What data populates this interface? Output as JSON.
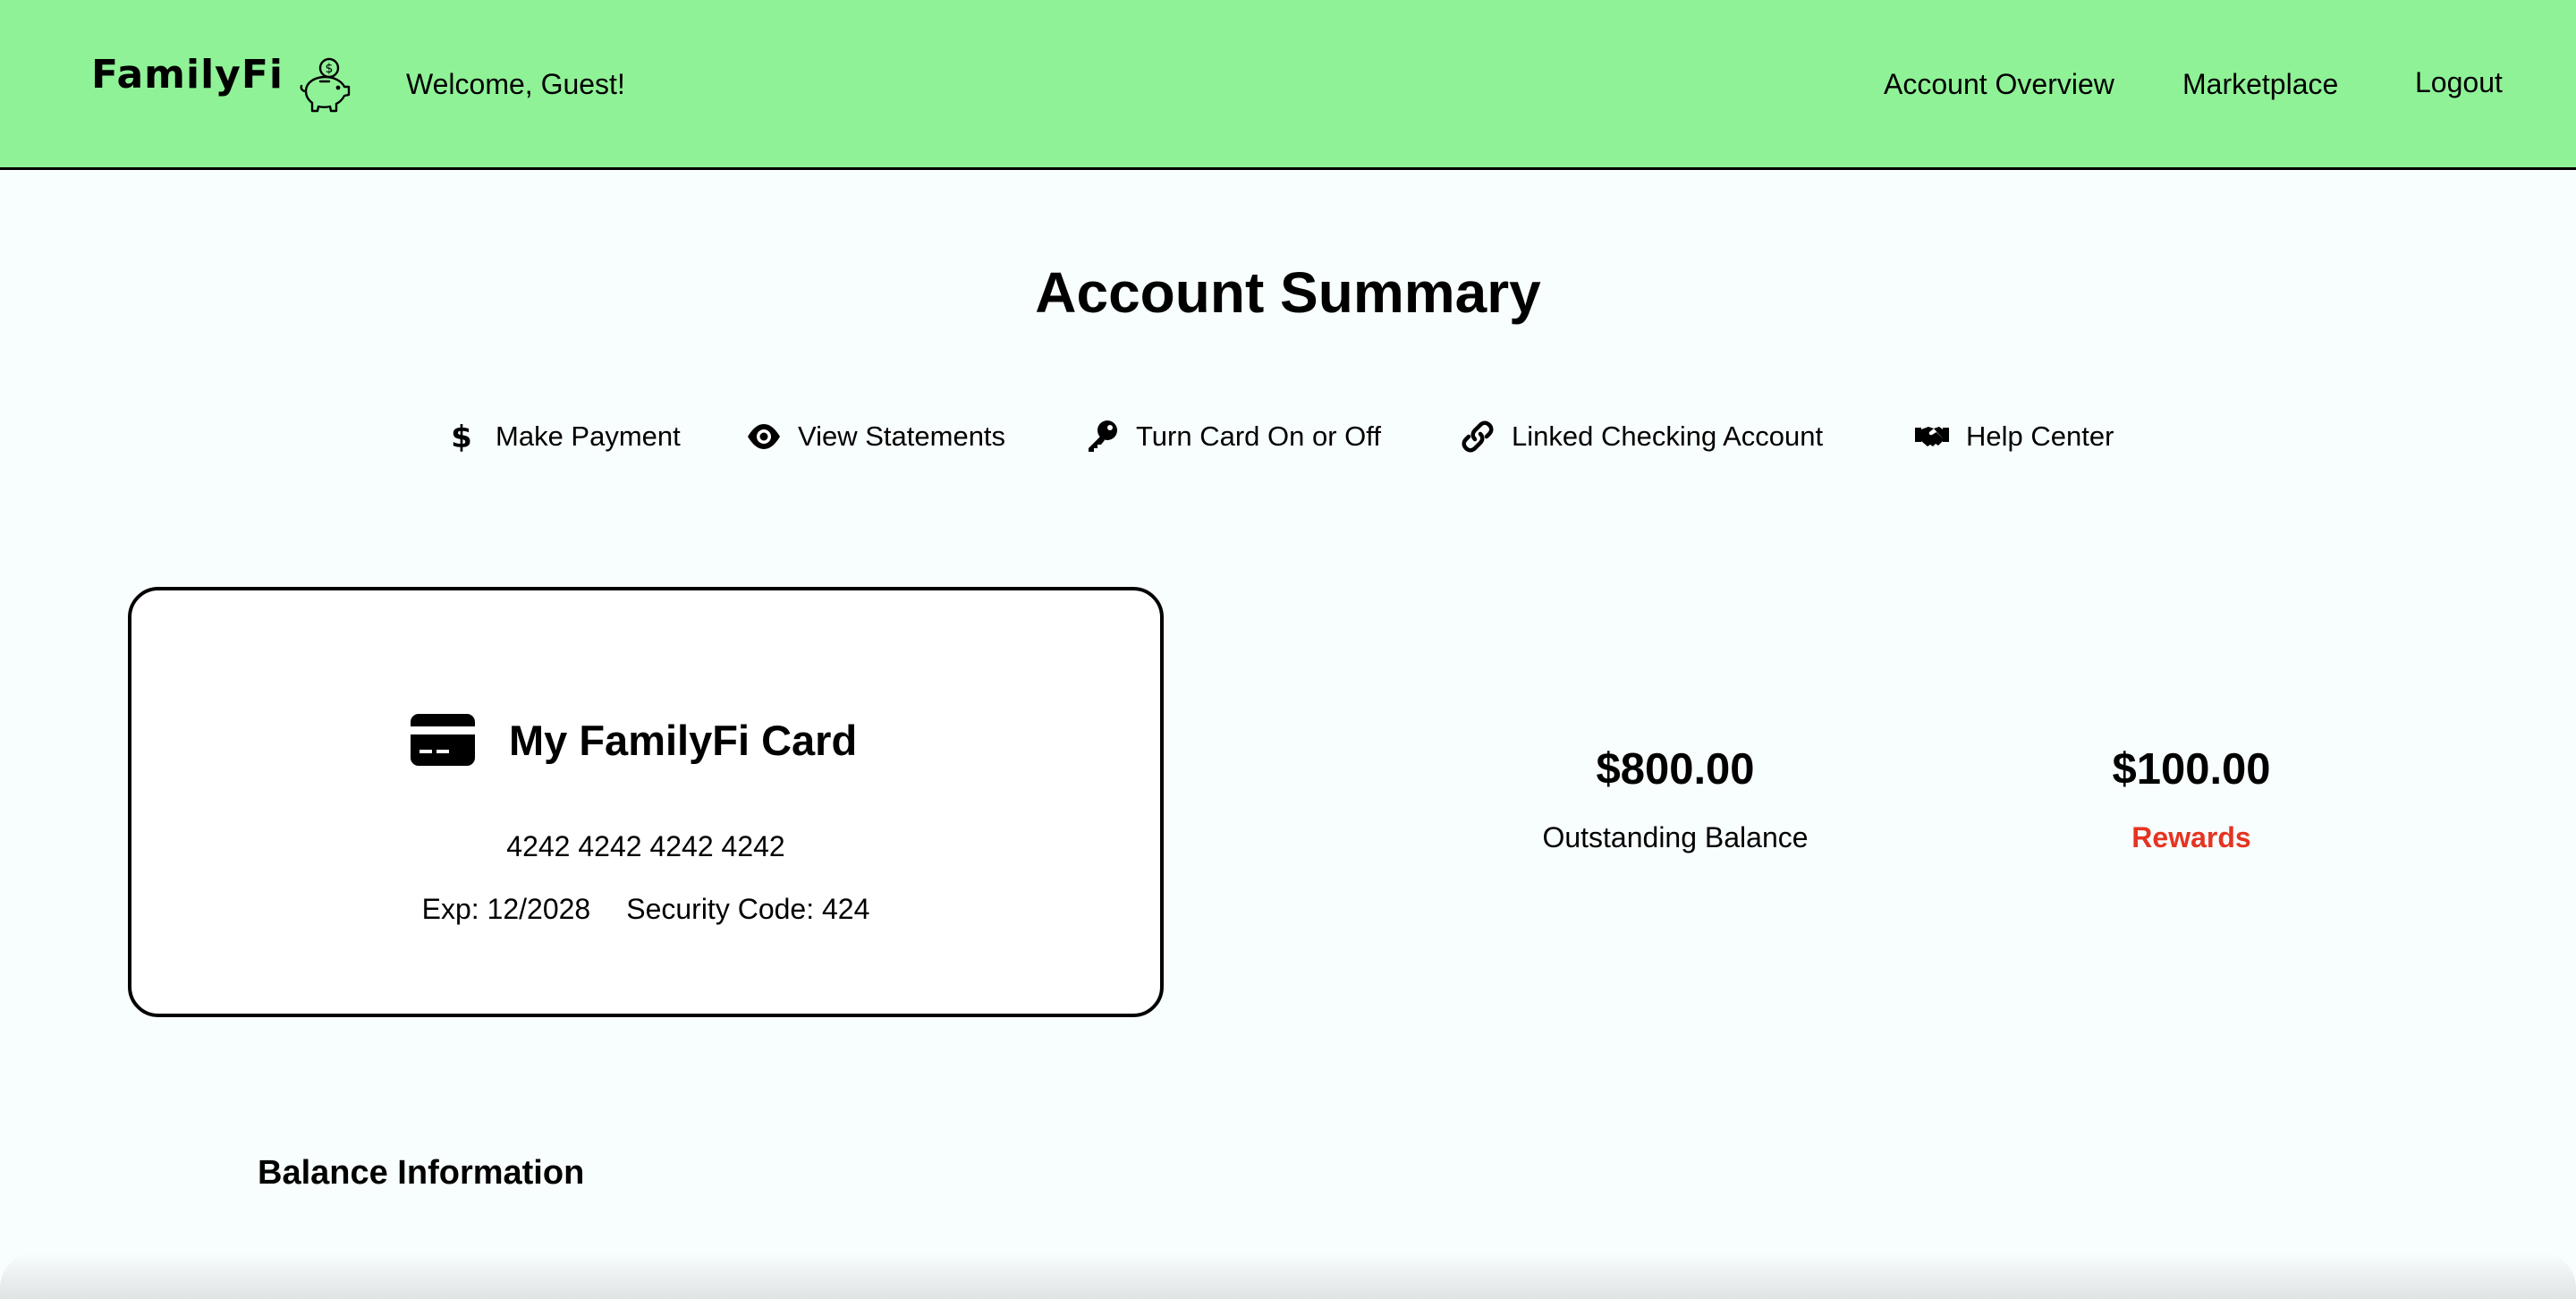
{
  "header": {
    "brand": "FamilyFi",
    "brand_icon": "piggy-bank-icon",
    "welcome": "Welcome, Guest!",
    "nav": {
      "overview": "Account Overview",
      "marketplace": "Marketplace",
      "logout": "Logout"
    },
    "background": "#90f297"
  },
  "page": {
    "title": "Account Summary"
  },
  "actions": {
    "make_payment": {
      "label": "Make Payment",
      "icon": "dollar-icon"
    },
    "view_statements": {
      "label": "View Statements",
      "icon": "eye-icon"
    },
    "turn_card": {
      "label": "Turn Card On or Off",
      "icon": "key-icon"
    },
    "linked_checking": {
      "label": "Linked Checking Account",
      "icon": "link-icon"
    },
    "help_center": {
      "label": "Help Center",
      "icon": "handshake-icon"
    }
  },
  "card": {
    "title": "My FamilyFi Card",
    "icon": "credit-card-icon",
    "number": "4242 4242 4242 4242",
    "exp": "Exp: 12/2028",
    "security": "Security Code: 424"
  },
  "balances": {
    "outstanding": {
      "value": "$800.00",
      "label": "Outstanding Balance"
    },
    "rewards": {
      "value": "$100.00",
      "label": "Rewards",
      "label_color": "#e53422"
    }
  },
  "sections": {
    "balance_information": "Balance Information"
  }
}
